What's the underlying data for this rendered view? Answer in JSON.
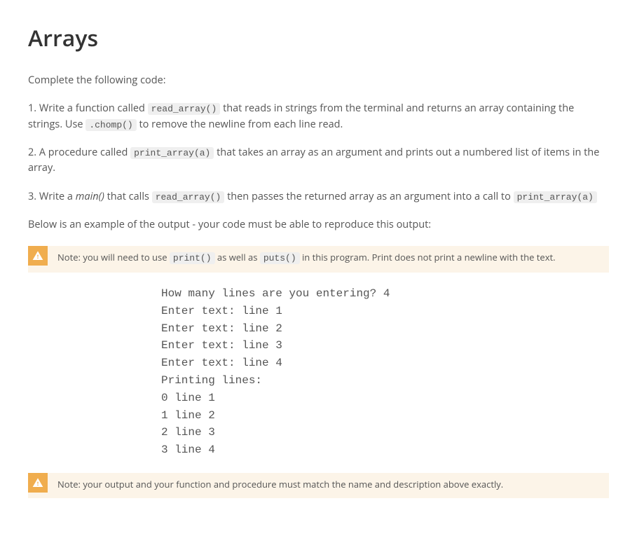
{
  "heading": "Arrays",
  "intro": "Complete the following code:",
  "step1": {
    "prefix": "1. Write a function called ",
    "code1": "read_array()",
    "mid": " that reads in strings from the terminal and returns an array containing the strings. Use ",
    "code2": ".chomp()",
    "suffix": " to remove the newline from each line read."
  },
  "step2": {
    "prefix": "2. A procedure called ",
    "code1": "print_array(a)",
    "suffix": " that takes an array as an argument and prints out a numbered list of items in the array."
  },
  "step3": {
    "prefix": "3. Write a ",
    "italic": "main()",
    "mid": " that calls ",
    "code1": "read_array()",
    "mid2": " then passes the returned array as an argument into a call to ",
    "code2": "print_array(a)"
  },
  "below": "Below is an example of the output - your code must be able to reproduce this output:",
  "note1": {
    "prefix": "Note: you will need to use ",
    "code1": "print()",
    "mid": " as well as ",
    "code2": "puts()",
    "suffix": " in this program. Print does not print a newline with the text."
  },
  "output": "How many lines are you entering? 4\nEnter text: line 1\nEnter text: line 2\nEnter text: line 3\nEnter text: line 4\nPrinting lines:\n0 line 1\n1 line 2\n2 line 3\n3 line 4",
  "note2": {
    "text": "Note: your output and your function and procedure must match the name and description above exactly."
  }
}
